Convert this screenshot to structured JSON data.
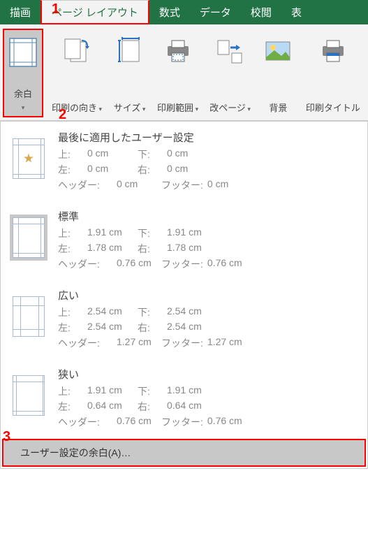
{
  "callouts": {
    "c1": "1",
    "c2": "2",
    "c3": "3"
  },
  "tabs": {
    "draw": "描画",
    "pagelayout": "ページ レイアウト",
    "formula": "数式",
    "data": "データ",
    "review": "校閲",
    "view": "表"
  },
  "toolbar": {
    "margins": "余白",
    "orientation": "印刷の向き",
    "size": "サイズ",
    "printarea": "印刷範囲",
    "breaks": "改ページ",
    "background": "背景",
    "printtitles": "印刷タイトル"
  },
  "panel": {
    "labels": {
      "top": "上:",
      "bottom": "下:",
      "left": "左:",
      "right": "右:",
      "header": "ヘッダー:",
      "footer": "フッター:"
    },
    "options": [
      {
        "title": "最後に適用したユーザー設定",
        "top": "0 cm",
        "bottom": "0 cm",
        "left": "0 cm",
        "right": "0 cm",
        "header": "0 cm",
        "footer": "0 cm",
        "star": true,
        "selected": false
      },
      {
        "title": "標準",
        "top": "1.91 cm",
        "bottom": "1.91 cm",
        "left": "1.78 cm",
        "right": "1.78 cm",
        "header": "0.76 cm",
        "footer": "0.76 cm",
        "star": false,
        "selected": true
      },
      {
        "title": "広い",
        "top": "2.54 cm",
        "bottom": "2.54 cm",
        "left": "2.54 cm",
        "right": "2.54 cm",
        "header": "1.27 cm",
        "footer": "1.27 cm",
        "star": false,
        "selected": false
      },
      {
        "title": "狭い",
        "top": "1.91 cm",
        "bottom": "1.91 cm",
        "left": "0.64 cm",
        "right": "0.64 cm",
        "header": "0.76 cm",
        "footer": "0.76 cm",
        "star": false,
        "selected": false
      }
    ],
    "custom": "ユーザー設定の余白(A)…"
  }
}
